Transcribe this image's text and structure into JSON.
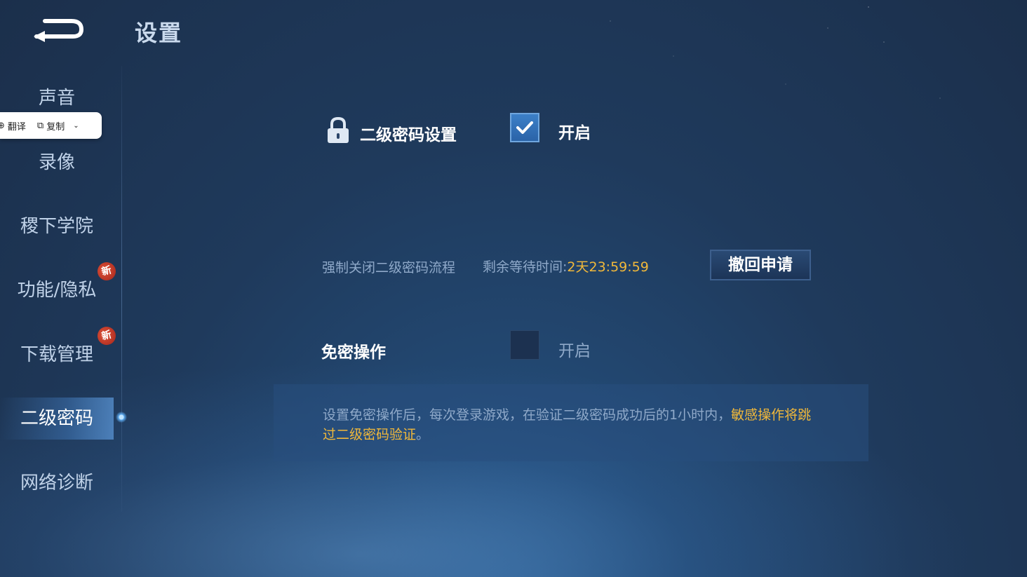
{
  "header": {
    "title": "设置"
  },
  "sidebar": {
    "items": [
      {
        "label": "声音"
      },
      {
        "label": "录像"
      },
      {
        "label": "稷下学院"
      },
      {
        "label": "功能/隐私",
        "badge": "新"
      },
      {
        "label": "下载管理",
        "badge": "新"
      },
      {
        "label": "二级密码",
        "active": true
      },
      {
        "label": "网络诊断"
      }
    ]
  },
  "popup_toolbar": {
    "translate": "翻译",
    "copy": "复制"
  },
  "second_password": {
    "label": "二级密码设置",
    "toggle_label": "开启",
    "checked": true
  },
  "force_close": {
    "label": "强制关闭二级密码流程",
    "wait_label": "剩余等待时间:",
    "countdown": "2天23:59:59",
    "revoke_button": "撤回申请"
  },
  "password_free": {
    "label": "免密操作",
    "toggle_label": "开启",
    "checked": false
  },
  "notice": {
    "text_normal": "设置免密操作后，每次登录游戏，在验证二级密码成功后的1小时内，",
    "text_highlight": "敏感操作将跳过二级密码验证",
    "text_end": "。"
  },
  "colors": {
    "highlight": "#f1b83a",
    "accent": "#3c80c8",
    "badge": "#c0392b"
  }
}
